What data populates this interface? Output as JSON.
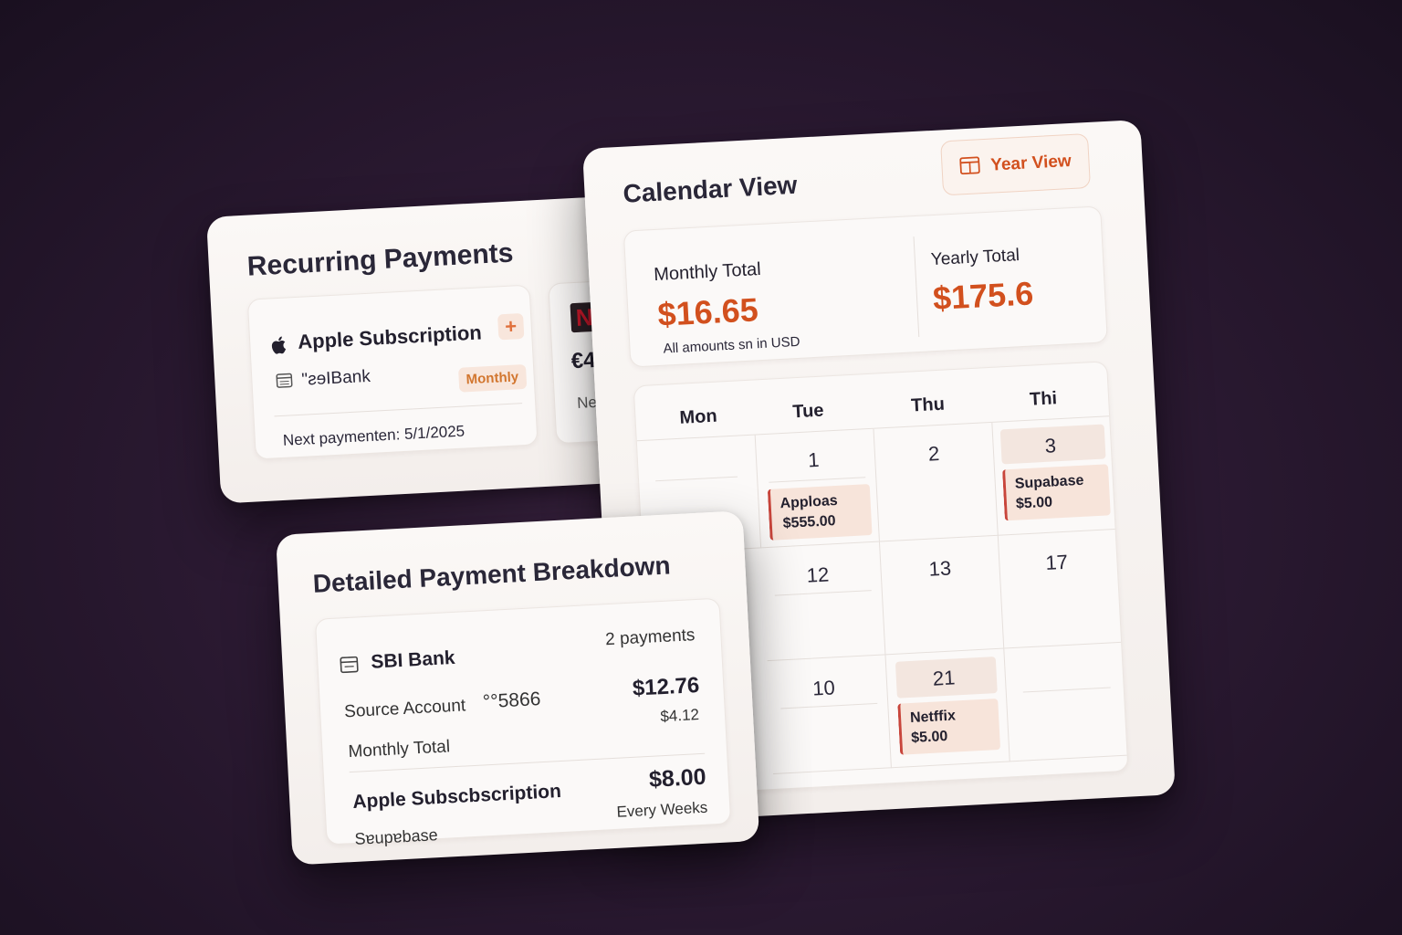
{
  "recurring": {
    "title": "Recurring Payments",
    "apple_card": {
      "name": "Apple Subscription",
      "bank": "\"ƨɘIBank",
      "frequency": "Monthly",
      "next_payment": "Next paymenten: 5/1/2025"
    },
    "second_card": {
      "logo_text": "N",
      "amount_partial": "€4",
      "next_partial": "Nex"
    }
  },
  "calendar": {
    "title": "Calendar View",
    "year_view_label": "Year View",
    "summary": {
      "monthly_label": "Monthly Total",
      "monthly_value": "$16.65",
      "note": "All  amounts sn in USD",
      "yearly_label": "Yearly Total",
      "yearly_value": "$175.6"
    },
    "weekdays": [
      "Mon",
      "Tue",
      "Thu",
      "Thi"
    ],
    "days": {
      "d1": "1",
      "d2": "2",
      "d3": "3",
      "d12": "12",
      "d13": "13",
      "d17": "17",
      "d10": "10",
      "d21": "21"
    },
    "events": {
      "e1_name": "Apploas",
      "e1_amount": "$555.00",
      "e3_name": "Supabase",
      "e3_amount": "$5.00",
      "e21_name": "Netffix",
      "e21_amount": "$5.00"
    }
  },
  "breakdown": {
    "title": "Detailed Payment Breakdown",
    "bank_name": "SBI Bank",
    "payment_count": "2 payments",
    "source_label": "Source Account",
    "account_mask": "°°5866",
    "amount_total": "$12.76",
    "amount_sub": "$4.12",
    "monthly_total_label": "Monthly  Total",
    "sub_name": "Apple Subscbscription",
    "sub_amount": "$8.00",
    "sub_source": "Sɐupɐbase",
    "sub_frequency": "Every Weeks"
  },
  "colors": {
    "accent": "#d2501e",
    "event_bg": "#f7e4da",
    "event_border": "#c8453b",
    "card_bg": "#fbf8f6"
  }
}
